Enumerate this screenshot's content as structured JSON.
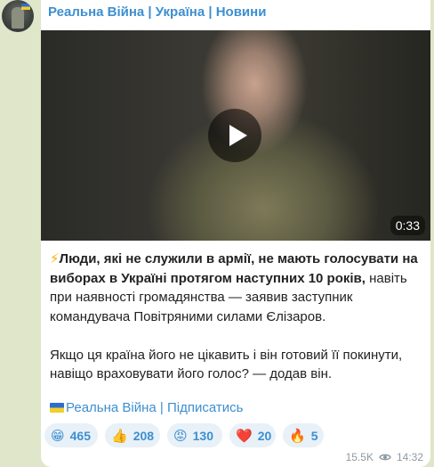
{
  "channel": {
    "title": "Реальна Війна | Україна | Новини"
  },
  "video": {
    "duration": "0:33"
  },
  "post": {
    "emoji": "⚡",
    "bold_part": "Люди, які не служили в армії, не мають голосувати на виборах в Україні протягом наступних 10 років,",
    "normal_part": " навіть при наявності громадянства — заявив заступник командувача Повітряними силами Єлізаров.",
    "paragraph2": "Якщо ця країна його не цікавить і він готовий її покинути, навіщо враховувати його голос? — додав він."
  },
  "subscribe": {
    "label": "Реальна Війна | Підписатись"
  },
  "reactions": [
    {
      "emoji": "😁",
      "count": "465"
    },
    {
      "emoji": "👍",
      "count": "208"
    },
    {
      "emoji": "😡",
      "count": "130"
    },
    {
      "emoji": "❤️",
      "count": "20"
    },
    {
      "emoji": "🔥",
      "count": "5"
    }
  ],
  "meta": {
    "views": "15.5K",
    "time": "14:32"
  },
  "colors": {
    "link": "#3d8fd0",
    "background": "#dfe6c9",
    "reaction_bg": "#e8f0f8"
  }
}
